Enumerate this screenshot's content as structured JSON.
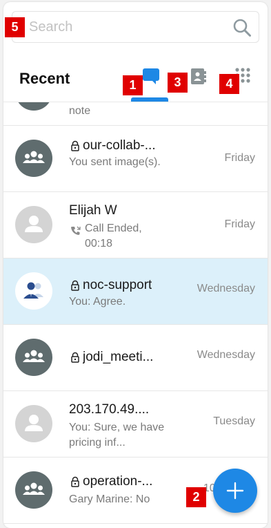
{
  "search": {
    "placeholder": "Search"
  },
  "header": {
    "title": "Recent"
  },
  "tabs": {
    "chat": "chat-icon",
    "contacts": "contacts-icon",
    "apps": "grid-icon"
  },
  "conversations": [
    {
      "name": "",
      "subtitle": "note",
      "time": ""
    },
    {
      "name": "our-collab-...",
      "subtitle": "You sent image(s).",
      "time": "Friday",
      "locked": true
    },
    {
      "name": "Elijah W",
      "subtitle": "Call Ended, 00:18",
      "time": "Friday",
      "locked": false
    },
    {
      "name": "noc-support",
      "subtitle": "You: Agree.",
      "time": "Wednesday",
      "locked": true
    },
    {
      "name": "jodi_meeti...",
      "subtitle": "",
      "time": "Wednesday",
      "locked": true
    },
    {
      "name": "203.170.49....",
      "subtitle": "You: Sure, we have pricing inf...",
      "time": "Tuesday",
      "locked": false
    },
    {
      "name": "operation-...",
      "subtitle": "Gary Marine: No",
      "time": "10/0",
      "locked": true
    }
  ],
  "badges": [
    "1",
    "2",
    "3",
    "4",
    "5"
  ],
  "colors": {
    "accent": "#1e88e5",
    "selected_row": "#dcf0fa",
    "group_avatar": "#5f6c6e",
    "badge": "#e00000"
  }
}
